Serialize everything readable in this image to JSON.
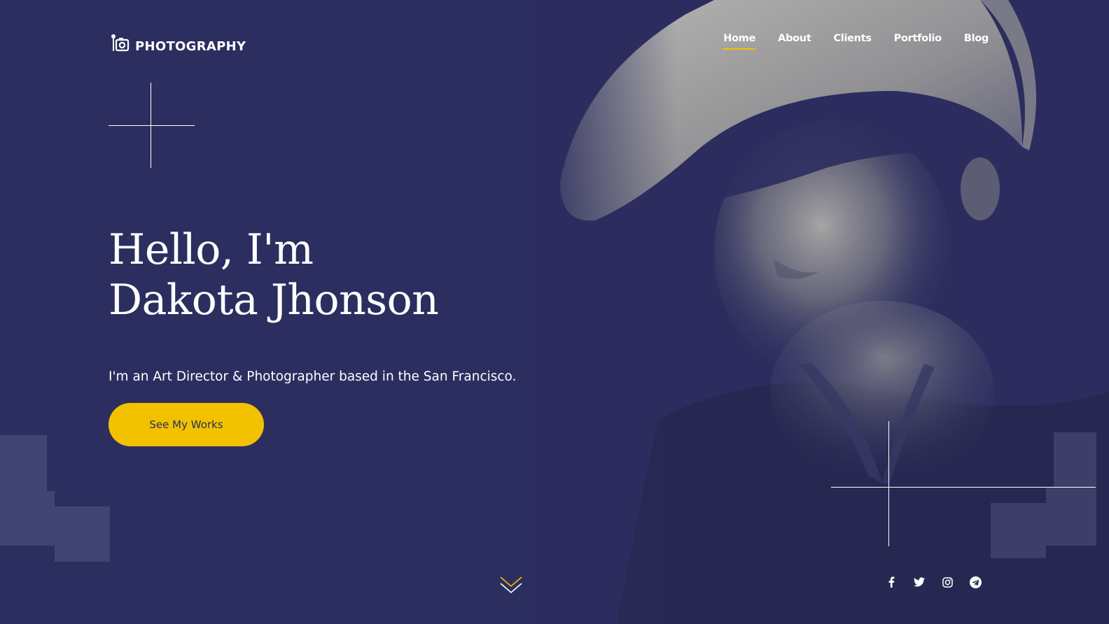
{
  "brand": {
    "name": "PHOTOGRAPHY",
    "icon": "camera-icon"
  },
  "nav": {
    "items": [
      {
        "label": "Home",
        "active": true
      },
      {
        "label": "About",
        "active": false
      },
      {
        "label": "Clients",
        "active": false
      },
      {
        "label": "Portfolio",
        "active": false
      },
      {
        "label": "Blog",
        "active": false
      }
    ]
  },
  "hero": {
    "headline_line1": "Hello, I'm",
    "headline_line2": "Dakota Jhonson",
    "tagline": "I'm an Art Director & Photographer based in the San Francisco.",
    "cta_label": "See My Works",
    "scroll_icon": "chevron-down-icon"
  },
  "social": [
    {
      "name": "facebook-icon"
    },
    {
      "name": "twitter-icon"
    },
    {
      "name": "instagram-icon"
    },
    {
      "name": "telegram-icon"
    }
  ],
  "colors": {
    "background": "#2c2e5f",
    "accent": "#f2c200",
    "text": "#ffffff"
  }
}
